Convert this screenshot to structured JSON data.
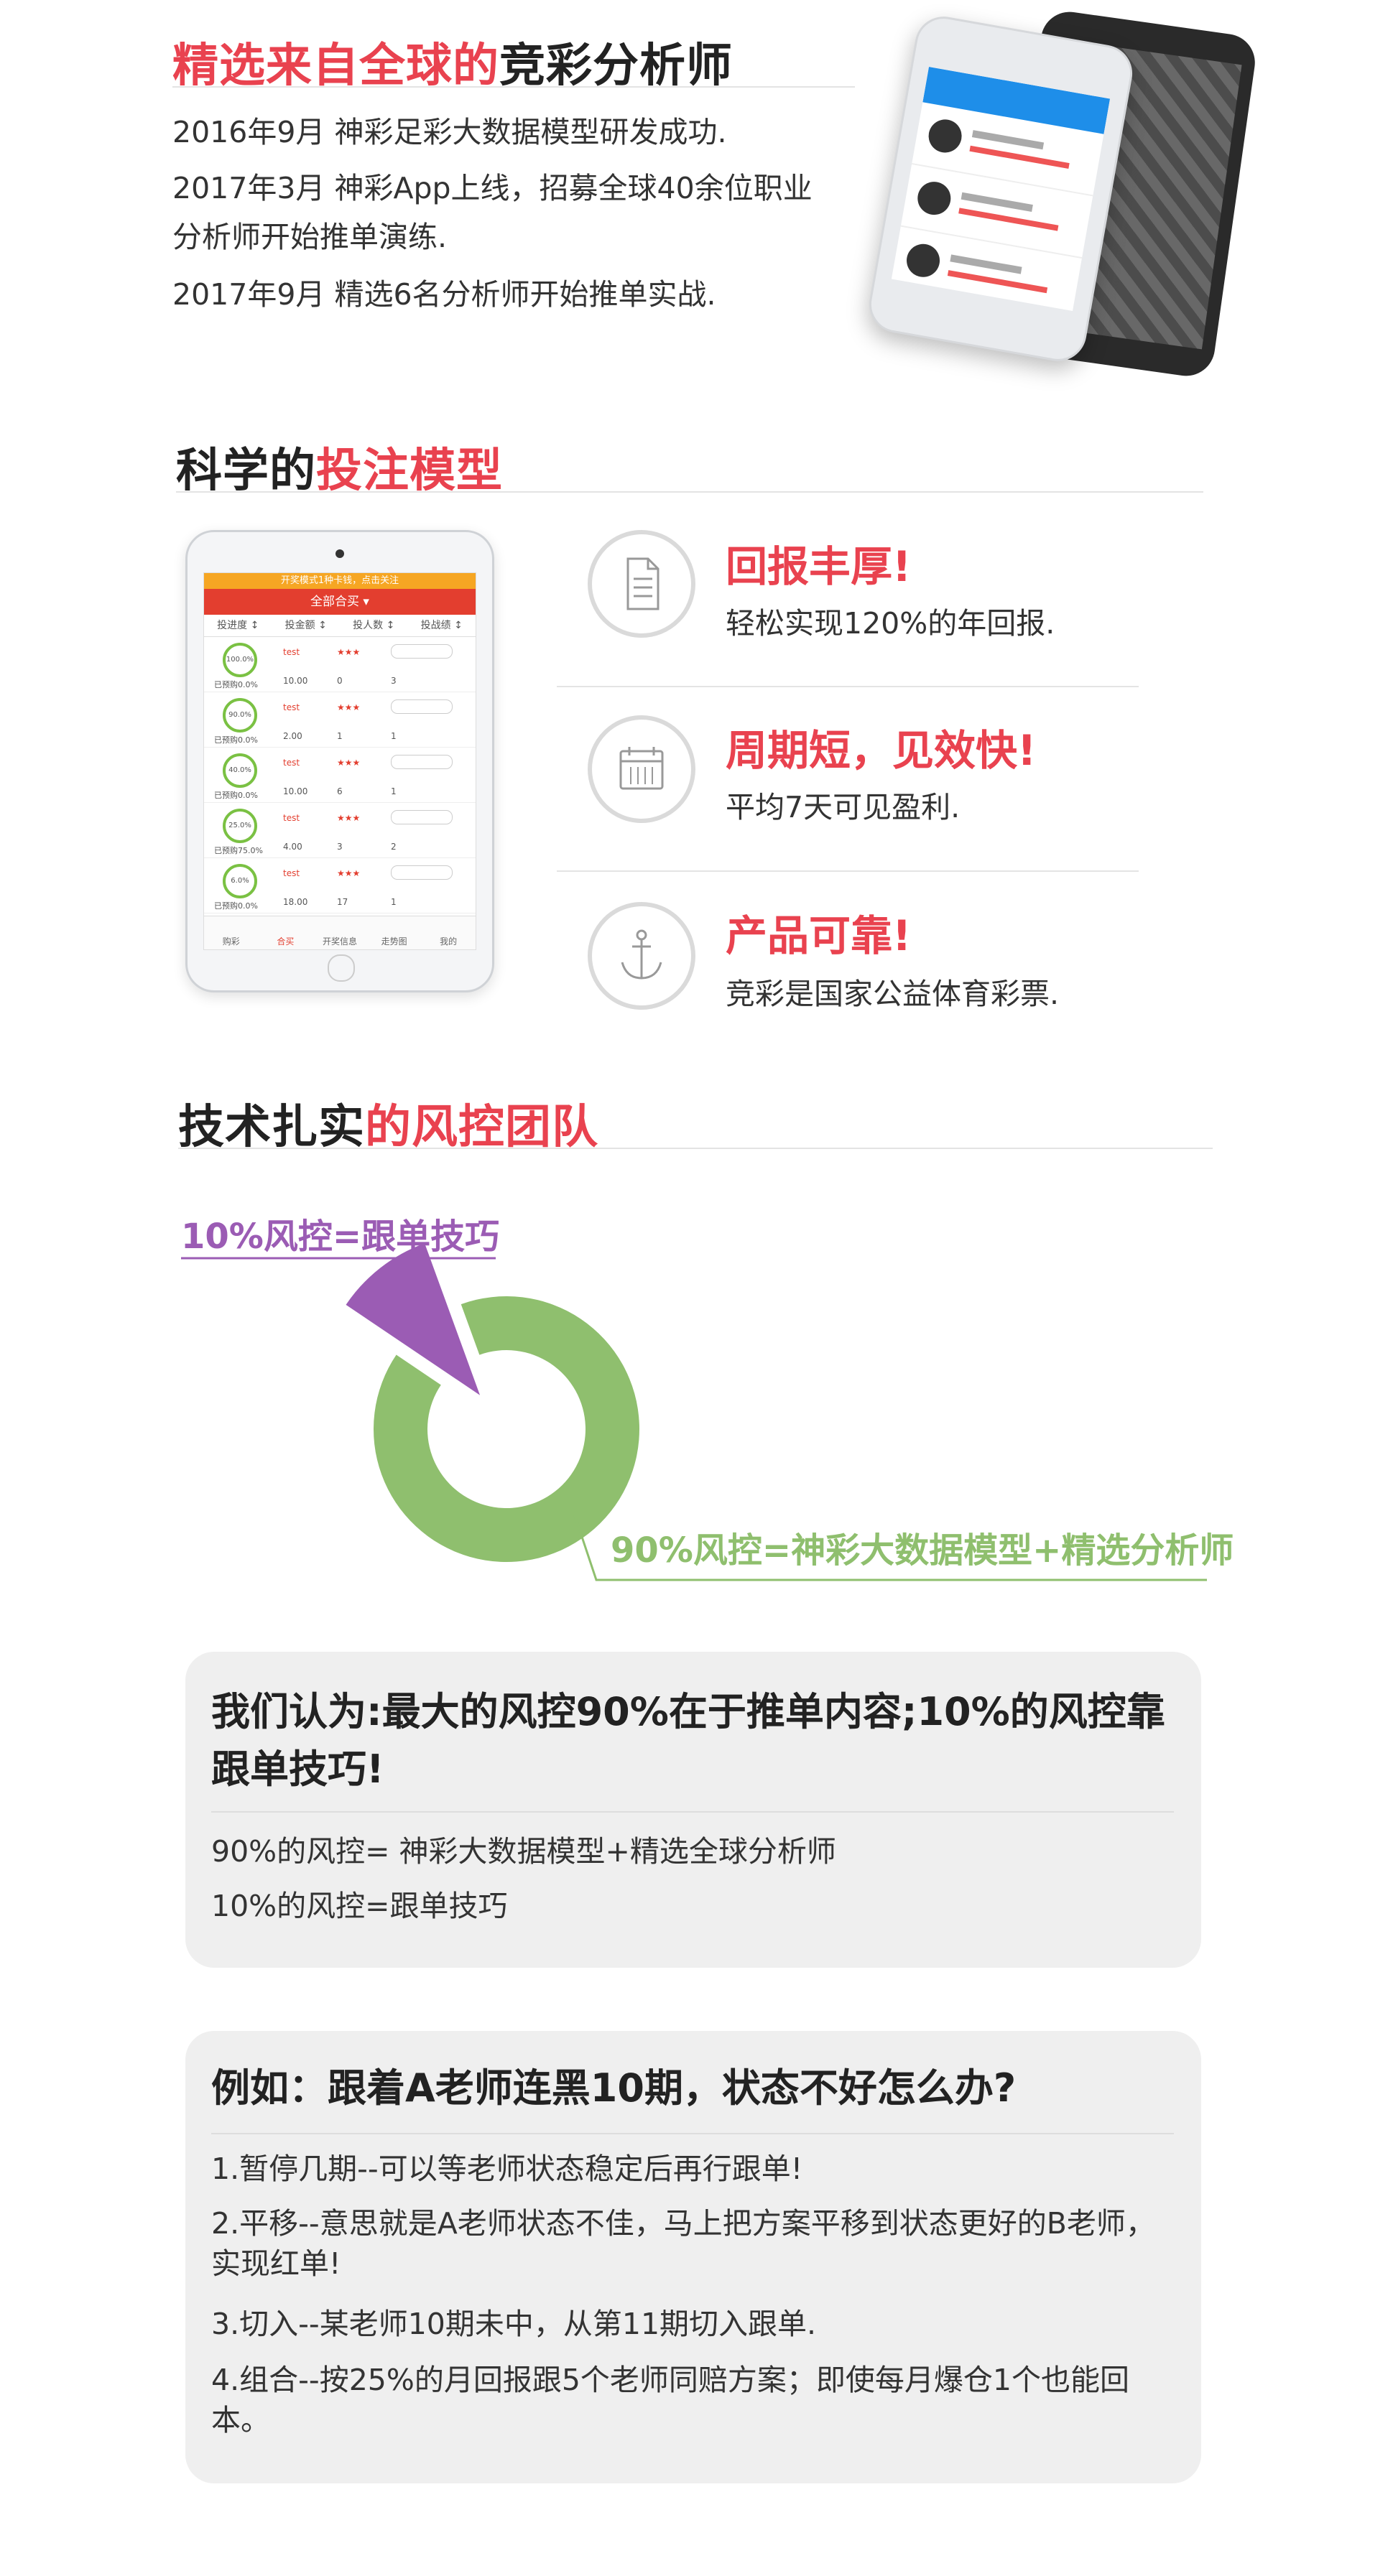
{
  "section1": {
    "title_highlight": "精选来自全球的",
    "title_rest": "竞彩分析师",
    "lines": [
      "2016年9月 神彩足彩大数据模型研发成功.",
      "2017年3月 神彩App上线，招募全球40余位职业",
      "分析师开始推单演练.",
      "2017年9月 精选6名分析师开始推单实战."
    ]
  },
  "section2": {
    "title_rest": "科学的",
    "title_highlight": "投注模型",
    "ipad": {
      "banner": "开奖模式1种卡钱，点击关注",
      "header": "全部合买 ▾",
      "columns": [
        "投进度 ↕",
        "投金额 ↕",
        "投人数 ↕",
        "投战绩 ↕"
      ],
      "rows": [
        {
          "ring": "100.0%",
          "pct": "已预购0.0%",
          "name": "test",
          "amount": "10.00",
          "count": "0",
          "record": "3"
        },
        {
          "ring": "90.0%",
          "pct": "已预购0.0%",
          "name": "test",
          "amount": "2.00",
          "count": "1",
          "record": "1"
        },
        {
          "ring": "40.0%",
          "pct": "已预购0.0%",
          "name": "test",
          "amount": "10.00",
          "count": "6",
          "record": "1"
        },
        {
          "ring": "25.0%",
          "pct": "已预购75.0%",
          "name": "test",
          "amount": "4.00",
          "count": "3",
          "record": "2"
        },
        {
          "ring": "6.0%",
          "pct": "已预购0.0%",
          "name": "test",
          "amount": "18.00",
          "count": "17",
          "record": "1"
        }
      ],
      "tabs": [
        "购彩",
        "合买",
        "开奖信息",
        "走势图",
        "我的"
      ]
    },
    "features": [
      {
        "icon": "document-icon",
        "title": "回报丰厚!",
        "desc": "轻松实现120%的年回报."
      },
      {
        "icon": "calendar-icon",
        "title": "周期短，见效快!",
        "desc": "平均7天可见盈利."
      },
      {
        "icon": "anchor-icon",
        "title": "产品可靠!",
        "desc": "竞彩是国家公益体育彩票."
      }
    ]
  },
  "section3": {
    "title_rest": "技术扎实",
    "title_highlight": "的风控团队"
  },
  "chart_data": {
    "type": "pie",
    "categories": [
      "10%风控=跟单技巧",
      "90%风控=神彩大数据模型+精选分析师"
    ],
    "values": [
      10,
      90
    ],
    "colors": [
      "#9b5cb4",
      "#8fbf6e"
    ],
    "title": ""
  },
  "card1": {
    "heading": "我们认为:最大的风控90%在于推单内容;10%的风控靠跟单技巧!",
    "lines": [
      "90%的风控= 神彩大数据模型+精选全球分析师",
      "10%的风控=跟单技巧"
    ]
  },
  "card2": {
    "heading": "例如：跟着A老师连黑10期，状态不好怎么办?",
    "lines": [
      "1.暂停几期--可以等老师状态稳定后再行跟单!",
      "2.平移--意思就是A老师状态不佳，马上把方案平移到状态更好的B老师，实现红单!",
      "3.切入--某老师10期未中，从第11期切入跟单.",
      "4.组合--按25%的月回报跟5个老师同赔方案；即使每月爆仓1个也能回本。"
    ]
  }
}
